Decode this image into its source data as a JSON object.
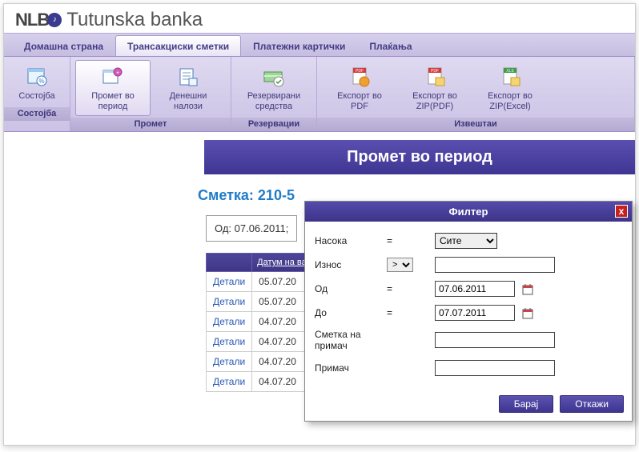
{
  "brand": {
    "nlb": "NLB",
    "badge": "♪",
    "bank": "Tutunska banka"
  },
  "mainTabs": [
    {
      "label": "Домашна страна",
      "active": false
    },
    {
      "label": "Трансакциски сметки",
      "active": true
    },
    {
      "label": "Платежни картички",
      "active": false
    },
    {
      "label": "Плаќања",
      "active": false
    }
  ],
  "ribbon": [
    {
      "group": "Состојба",
      "buttons": [
        {
          "label": "Состојба",
          "icon": "balance"
        }
      ]
    },
    {
      "group": "Промет",
      "buttons": [
        {
          "label": "Промет во период",
          "icon": "turnover",
          "active": true
        },
        {
          "label": "Денешни налози",
          "icon": "orders"
        }
      ]
    },
    {
      "group": "Резервации",
      "buttons": [
        {
          "label": "Резервирани средства",
          "icon": "reserved"
        }
      ]
    },
    {
      "group": "Извештаи",
      "buttons": [
        {
          "label": "Експорт во PDF",
          "icon": "pdf"
        },
        {
          "label": "Експорт во ZIP(PDF)",
          "icon": "zippdf"
        },
        {
          "label": "Експорт во ZIP(Excel)",
          "icon": "zipxls"
        }
      ]
    }
  ],
  "page": {
    "title": "Промет во период",
    "account_label": "Сметка: 210-5",
    "date_range": "Од: 07.06.2011;"
  },
  "table": {
    "headers": [
      "",
      "Датум на валута"
    ],
    "rows": [
      {
        "link": "Детали",
        "date": "05.07.20"
      },
      {
        "link": "Детали",
        "date": "05.07.20"
      },
      {
        "link": "Детали",
        "date": "04.07.20"
      },
      {
        "link": "Детали",
        "date": "04.07.20"
      },
      {
        "link": "Детали",
        "date": "04.07.20"
      },
      {
        "link": "Детали",
        "date": "04.07.20"
      }
    ]
  },
  "filter": {
    "title": "Филтер",
    "labels": {
      "direction": "Насока",
      "amount": "Износ",
      "from": "Од",
      "to": "До",
      "recip_account": "Сметка на примач",
      "recipient": "Примач"
    },
    "ops": {
      "eq": "=",
      "gt_selected": ">"
    },
    "gt_options": [
      ">",
      "<",
      "="
    ],
    "direction_value": "Сите",
    "direction_options": [
      "Сите"
    ],
    "from_value": "07.06.2011",
    "to_value": "07.07.2011",
    "amount_value": "",
    "recip_account_value": "",
    "recipient_value": "",
    "buttons": {
      "search": "Барај",
      "cancel": "Откажи"
    }
  }
}
